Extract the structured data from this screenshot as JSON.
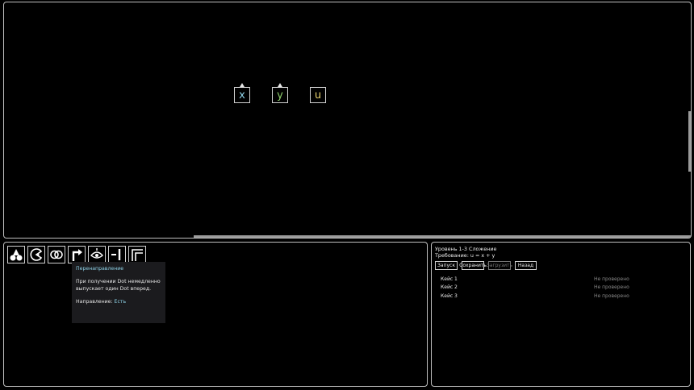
{
  "canvas": {
    "nodes": [
      {
        "id": "x",
        "label": "x",
        "color": "#8fd3e8",
        "has_arrow": true
      },
      {
        "id": "y",
        "label": "y",
        "color": "#8ed06b",
        "has_arrow": true
      },
      {
        "id": "u",
        "label": "u",
        "color": "#e6d06b",
        "has_arrow": false
      }
    ]
  },
  "tools": [
    {
      "name": "split-tool",
      "icon": "split-icon"
    },
    {
      "name": "eater-tool",
      "icon": "pacman-icon"
    },
    {
      "name": "merge-tool",
      "icon": "rings-icon"
    },
    {
      "name": "redirect-tool",
      "icon": "turn-arrow-icon"
    },
    {
      "name": "eye-tool",
      "icon": "eye-icon"
    },
    {
      "name": "gate-tool",
      "icon": "gate-icon"
    },
    {
      "name": "corner-tool",
      "icon": "corner-icon"
    }
  ],
  "tooltip": {
    "title": "Перенаправление",
    "description": "При получении Dot немедленно выпускает один Dot вперед.",
    "direction_label": "Направление:",
    "direction_value": "Есть"
  },
  "level": {
    "title": "Уровень 1-3  Сложение",
    "requirement": "Требование: u = x + y",
    "buttons": {
      "run": "Запуск",
      "save": "Сохранить",
      "load": "Загрузить",
      "back": "Назад"
    },
    "cases": [
      {
        "name": "Кейс 1",
        "status": "Не проверено"
      },
      {
        "name": "Кейс 2",
        "status": "Не проверено"
      },
      {
        "name": "Кейс 3",
        "status": "Не проверено"
      }
    ]
  }
}
